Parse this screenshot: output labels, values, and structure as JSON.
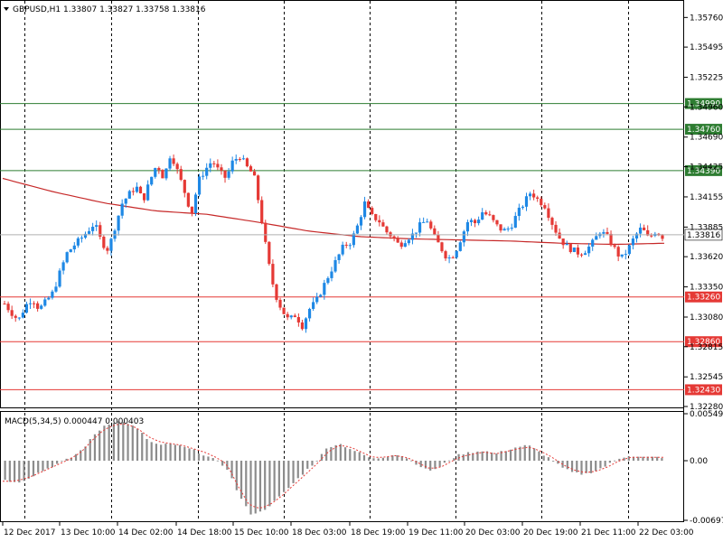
{
  "header": {
    "symbol_line": "GBPUSD,H1  1.33807 1.33827 1.33758 1.33816"
  },
  "macd_header": "MACD(5,34,5)  0.000447 0.000403",
  "current_price": "1.33816",
  "colors": {
    "bull": "#1e88e5",
    "bear": "#e53935",
    "ma": "#c62828",
    "support": "#e53935",
    "resistance": "#2e7d32",
    "macd_hist": "#8c8c8c",
    "macd_signal": "#e53935",
    "grid": "#000000",
    "current_line": "#b0b0b0",
    "current_label_bg": "#ffffff"
  },
  "chart_data": [
    {
      "type": "candlestick",
      "title": "GBPUSD,H1",
      "ylim": [
        1.3228,
        1.359
      ],
      "y_ticks": [
        "1.35760",
        "1.35495",
        "1.35225",
        "1.34960",
        "1.34690",
        "1.34425",
        "1.34155",
        "1.33885",
        "1.33620",
        "1.33350",
        "1.33080",
        "1.32815",
        "1.32545",
        "1.32280"
      ],
      "x_labels": [
        "12 Dec 2017",
        "13 Dec 10:00",
        "14 Dec 02:00",
        "14 Dec 18:00",
        "15 Dec 10:00",
        "18 Dec 03:00",
        "18 Dec 19:00",
        "19 Dec 11:00",
        "20 Dec 03:00",
        "20 Dec 19:00",
        "21 Dec 11:00",
        "22 Dec 03:00"
      ],
      "levels": [
        {
          "value": 1.3499,
          "label": "1.34990",
          "kind": "resistance"
        },
        {
          "value": 1.3476,
          "label": "1.34760",
          "kind": "resistance"
        },
        {
          "value": 1.3439,
          "label": "1.34390",
          "kind": "resistance"
        },
        {
          "value": 1.3326,
          "label": "1.33260",
          "kind": "support"
        },
        {
          "value": 1.3286,
          "label": "1.32860",
          "kind": "support"
        },
        {
          "value": 1.3243,
          "label": "1.32430",
          "kind": "support"
        }
      ],
      "close_path": [
        1.332,
        1.3312,
        1.3305,
        1.3318,
        1.3325,
        1.3315,
        1.3322,
        1.333,
        1.3348,
        1.3365,
        1.3372,
        1.3378,
        1.3385,
        1.3392,
        1.3375,
        1.3368,
        1.339,
        1.341,
        1.3418,
        1.3425,
        1.3412,
        1.343,
        1.3445,
        1.3432,
        1.3455,
        1.3438,
        1.342,
        1.34,
        1.343,
        1.344,
        1.3448,
        1.3438,
        1.3432,
        1.3448,
        1.3452,
        1.3442,
        1.3435,
        1.34,
        1.336,
        1.333,
        1.3315,
        1.3305,
        1.331,
        1.33,
        1.3315,
        1.3322,
        1.3335,
        1.3348,
        1.336,
        1.3372,
        1.3375,
        1.339,
        1.341,
        1.3398,
        1.3395,
        1.3385,
        1.338,
        1.3372,
        1.3378,
        1.3382,
        1.339,
        1.3395,
        1.338,
        1.337,
        1.336,
        1.3365,
        1.338,
        1.3395,
        1.3392,
        1.3402,
        1.3398,
        1.339,
        1.3385,
        1.3388,
        1.34,
        1.341,
        1.342,
        1.3413,
        1.3408,
        1.3393,
        1.338,
        1.3372,
        1.3368,
        1.3365,
        1.3368,
        1.3375,
        1.3385,
        1.338,
        1.337,
        1.336,
        1.3368,
        1.338,
        1.3388,
        1.3378,
        1.3385,
        1.338
      ],
      "ma_path": [
        1.3432,
        1.342,
        1.341,
        1.3403,
        1.34,
        1.3393,
        1.3385,
        1.338,
        1.3378,
        1.3377,
        1.3376,
        1.3374,
        1.3373,
        1.3374
      ],
      "macd": {
        "ylim": [
          -0.00697,
          0.00549
        ],
        "ticks": [
          "0.00549",
          "0.00",
          "-0.006971"
        ],
        "hist_path": [
          -0.0022,
          -0.0026,
          -0.0021,
          -0.0014,
          -0.0008,
          -0.0002,
          0.0004,
          0.0014,
          0.003,
          0.0042,
          0.0046,
          0.0044,
          0.0036,
          0.0022,
          0.0018,
          0.002,
          0.0016,
          0.0012,
          0.0006,
          0.0,
          -0.001,
          -0.004,
          -0.0062,
          -0.006,
          -0.005,
          -0.0038,
          -0.0025,
          -0.0012,
          0.0,
          0.0016,
          0.002,
          0.0014,
          0.0008,
          0.0002,
          0.0004,
          0.0008,
          0.0004,
          -0.0004,
          -0.0012,
          -0.0008,
          0.0002,
          0.0008,
          0.001,
          0.0012,
          0.0008,
          0.0012,
          0.0016,
          0.0018,
          0.001,
          0.0002,
          -0.0008,
          -0.0014,
          -0.0016,
          -0.0012,
          -0.0006,
          0.0002,
          0.0006,
          0.0004,
          0.0004,
          0.0004
        ],
        "signal_path": [
          -0.0024,
          -0.0024,
          -0.0021,
          -0.0016,
          -0.001,
          -0.0004,
          0.0002,
          0.001,
          0.0024,
          0.0036,
          0.0042,
          0.0043,
          0.0038,
          0.0028,
          0.0022,
          0.002,
          0.0018,
          0.0014,
          0.001,
          0.0004,
          -0.0004,
          -0.003,
          -0.0052,
          -0.0056,
          -0.005,
          -0.004,
          -0.0028,
          -0.0016,
          -0.0004,
          0.001,
          0.0018,
          0.0016,
          0.001,
          0.0004,
          0.0004,
          0.0006,
          0.0004,
          -0.0002,
          -0.0009,
          -0.0008,
          -0.0001,
          0.0005,
          0.0008,
          0.001,
          0.0008,
          0.0011,
          0.0014,
          0.0016,
          0.0011,
          0.0004,
          -0.0005,
          -0.0011,
          -0.0014,
          -0.0012,
          -0.0007,
          0.0,
          0.0004,
          0.0004,
          0.0004,
          0.0004
        ]
      }
    }
  ]
}
